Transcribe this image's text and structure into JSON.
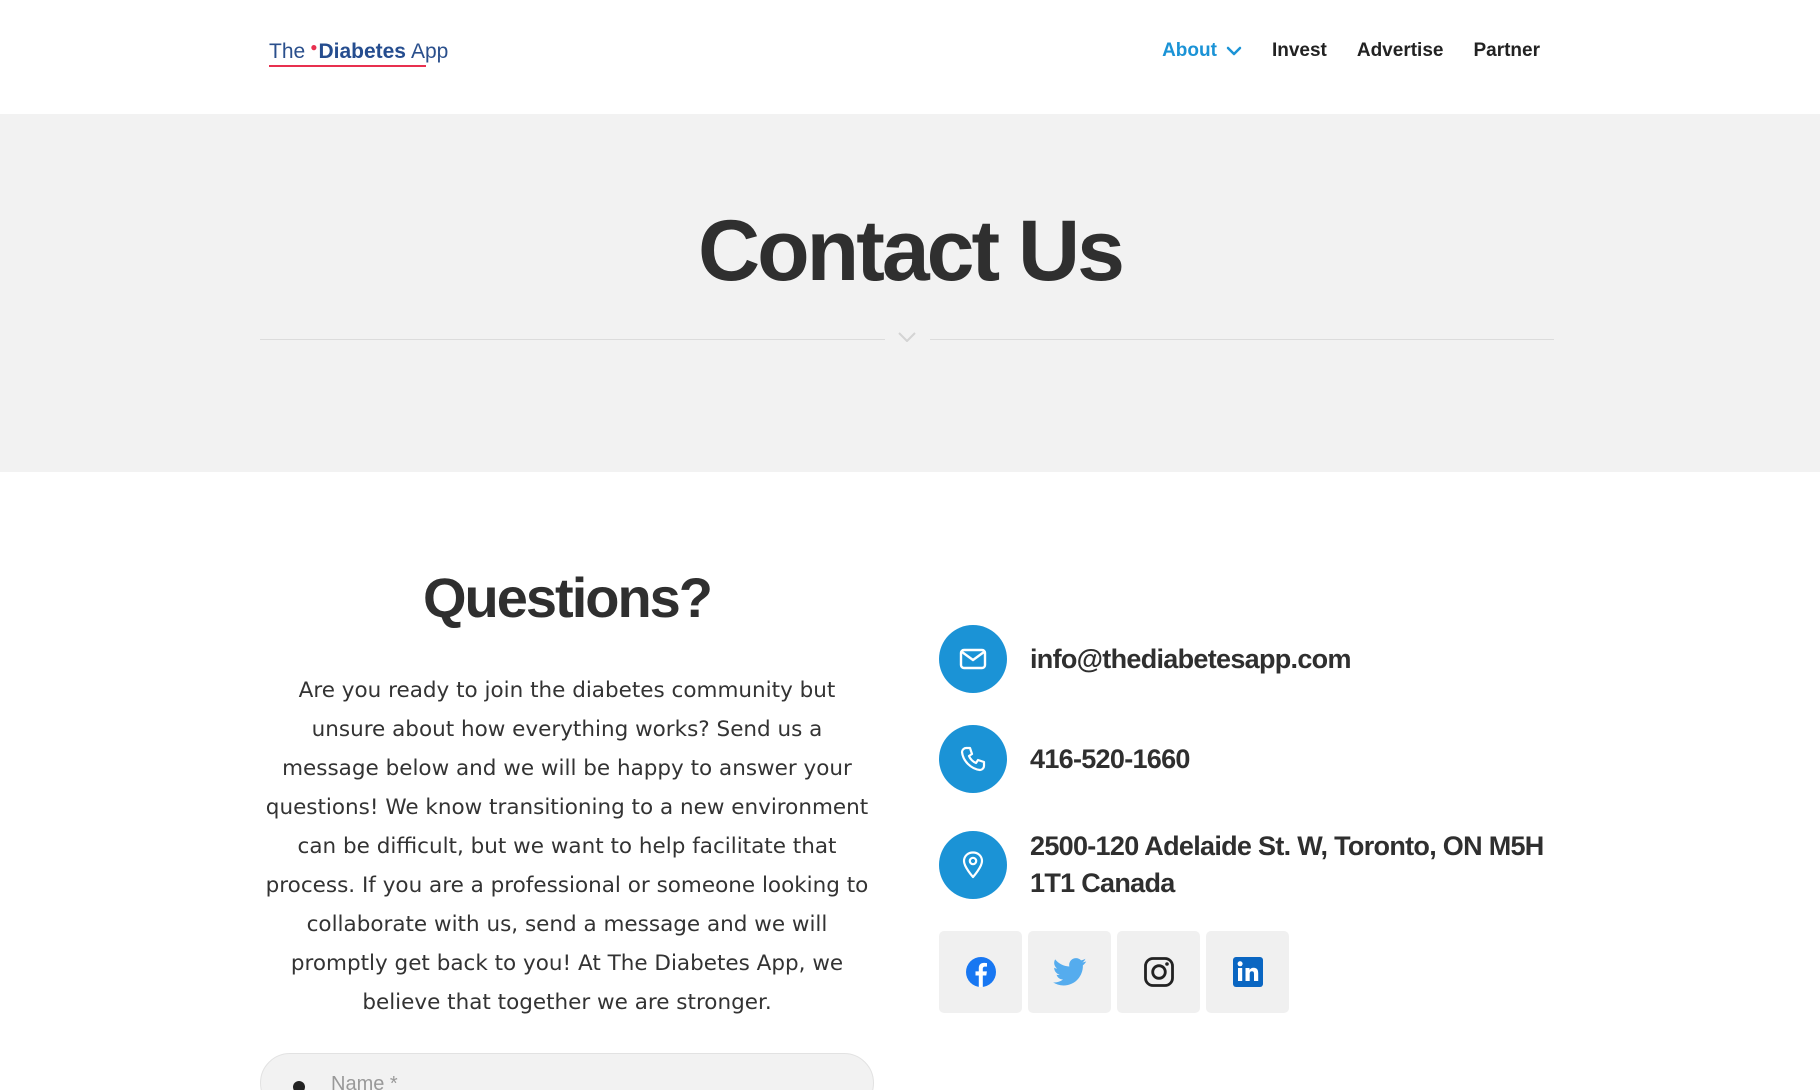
{
  "header": {
    "logo": {
      "the": "The",
      "diabetes": "Diabetes",
      "app": "App"
    },
    "nav": [
      {
        "label": "About",
        "active": true,
        "has_dropdown": true
      },
      {
        "label": "Invest"
      },
      {
        "label": "Advertise"
      },
      {
        "label": "Partner"
      }
    ]
  },
  "hero": {
    "title": "Contact Us"
  },
  "questions": {
    "title": "Questions?",
    "body": "Are you ready to join the diabetes community but unsure about how everything works? Send us a message below and we will be happy to answer your questions! We know transitioning to a new environment can be difficult, but we want to help facilitate that process. If you are a professional or someone looking to collaborate with us, send a message and we will promptly get back to you! At The Diabetes App, we believe that together we are stronger."
  },
  "form": {
    "name_placeholder": "Name *"
  },
  "contact": {
    "email": "info@thediabetesapp.com",
    "phone": "416-520-1660",
    "address": "2500-120 Adelaide St. W, Toronto, ON M5H 1T1 Canada"
  },
  "socials": [
    "facebook-icon",
    "twitter-icon",
    "instagram-icon",
    "linkedin-icon"
  ],
  "colors": {
    "accent": "#1b93d6",
    "logo_red": "#e8304f",
    "logo_blue": "#254d8f",
    "hero_bg": "#f2f2f2"
  }
}
